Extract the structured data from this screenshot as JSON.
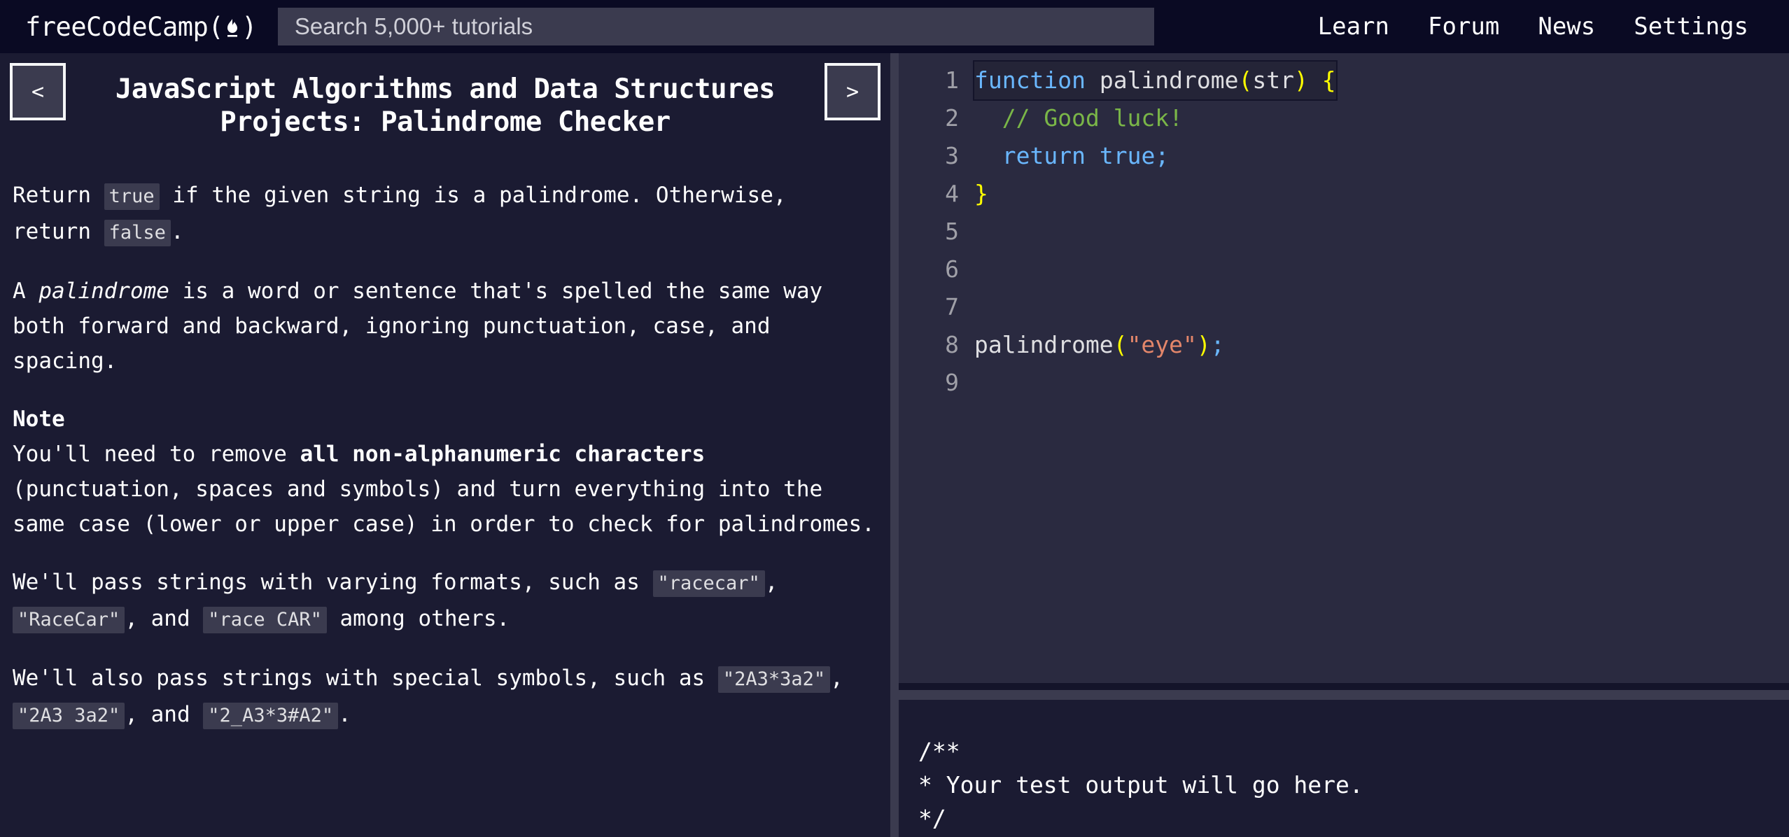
{
  "header": {
    "logo_text": "freeCodeCamp",
    "logo_flame_icon": "flame-icon",
    "logo_open_paren": "(",
    "logo_close_paren": ")",
    "search": {
      "placeholder": "Search 5,000+ tutorials",
      "value": ""
    },
    "nav": [
      {
        "label": "Learn"
      },
      {
        "label": "Forum"
      },
      {
        "label": "News"
      },
      {
        "label": "Settings"
      }
    ]
  },
  "challenge": {
    "prev_label": "<",
    "next_label": ">",
    "title": "JavaScript Algorithms and Data Structures Projects: Palindrome Checker",
    "paragraphs": {
      "p1_a": "Return ",
      "p1_code1": "true",
      "p1_b": " if the given string is a palindrome. Otherwise, return ",
      "p1_code2": "false",
      "p1_c": ".",
      "p2_a": "A ",
      "p2_em": "palindrome",
      "p2_b": " is a word or sentence that's spelled the same way both forward and backward, ignoring punctuation, case, and spacing.",
      "note_heading": "Note",
      "p3_a": "You'll need to remove ",
      "p3_strong": "all non-alphanumeric characters",
      "p3_b": " (punctuation, spaces and symbols) and turn everything into the same case (lower or upper case) in order to check for palindromes.",
      "p4_a": "We'll pass strings with varying formats, such as ",
      "p4_code1": "\"racecar\"",
      "p4_b": ", ",
      "p4_code2": "\"RaceCar\"",
      "p4_c": ", and ",
      "p4_code3": "\"race CAR\"",
      "p4_d": " among others.",
      "p5_a": "We'll also pass strings with special symbols, such as ",
      "p5_code1": "\"2A3*3a2\"",
      "p5_b": ", ",
      "p5_code2": "\"2A3 3a2\"",
      "p5_c": ", and ",
      "p5_code3": "\"2_A3*3#A2\"",
      "p5_d": "."
    }
  },
  "editor": {
    "lines": [
      {
        "num": "1",
        "tokens": [
          {
            "t": "function",
            "c": "tok-kw"
          },
          {
            "t": " ",
            "c": "tok-plain"
          },
          {
            "t": "palindrome",
            "c": "tok-fn"
          },
          {
            "t": "(",
            "c": "tok-par"
          },
          {
            "t": "str",
            "c": "tok-plain"
          },
          {
            "t": ")",
            "c": "tok-par"
          },
          {
            "t": " ",
            "c": "tok-plain"
          },
          {
            "t": "{",
            "c": "tok-par"
          }
        ],
        "highlight": true
      },
      {
        "num": "2",
        "tokens": [
          {
            "t": "  ",
            "c": "tok-plain"
          },
          {
            "t": "// Good luck!",
            "c": "tok-com"
          }
        ],
        "highlight": false
      },
      {
        "num": "3",
        "tokens": [
          {
            "t": "  ",
            "c": "tok-plain"
          },
          {
            "t": "return",
            "c": "tok-kw"
          },
          {
            "t": " ",
            "c": "tok-plain"
          },
          {
            "t": "true",
            "c": "tok-kw"
          },
          {
            "t": ";",
            "c": "tok-pun"
          }
        ],
        "highlight": false
      },
      {
        "num": "4",
        "tokens": [
          {
            "t": "}",
            "c": "tok-par"
          }
        ],
        "highlight": false
      },
      {
        "num": "5",
        "tokens": [],
        "highlight": false
      },
      {
        "num": "6",
        "tokens": [],
        "highlight": false
      },
      {
        "num": "7",
        "tokens": [],
        "highlight": false
      },
      {
        "num": "8",
        "tokens": [
          {
            "t": "palindrome",
            "c": "tok-fn"
          },
          {
            "t": "(",
            "c": "tok-par"
          },
          {
            "t": "\"eye\"",
            "c": "tok-str"
          },
          {
            "t": ")",
            "c": "tok-par"
          },
          {
            "t": ";",
            "c": "tok-pun"
          }
        ],
        "highlight": false
      },
      {
        "num": "9",
        "tokens": [],
        "highlight": false
      }
    ]
  },
  "console": {
    "text": "/**\n* Your test output will go here.\n*/"
  },
  "colors": {
    "page_bg": "#0a0a23",
    "panel_bg": "#1b1b32",
    "editor_bg": "#2a2a40",
    "divider": "#3b3b4f",
    "text": "#ffffff",
    "keyword": "#6ab7ff",
    "string": "#e3866a",
    "comment": "#7ab648",
    "paren": "#ffff00",
    "line_number": "#a0a0a8"
  }
}
